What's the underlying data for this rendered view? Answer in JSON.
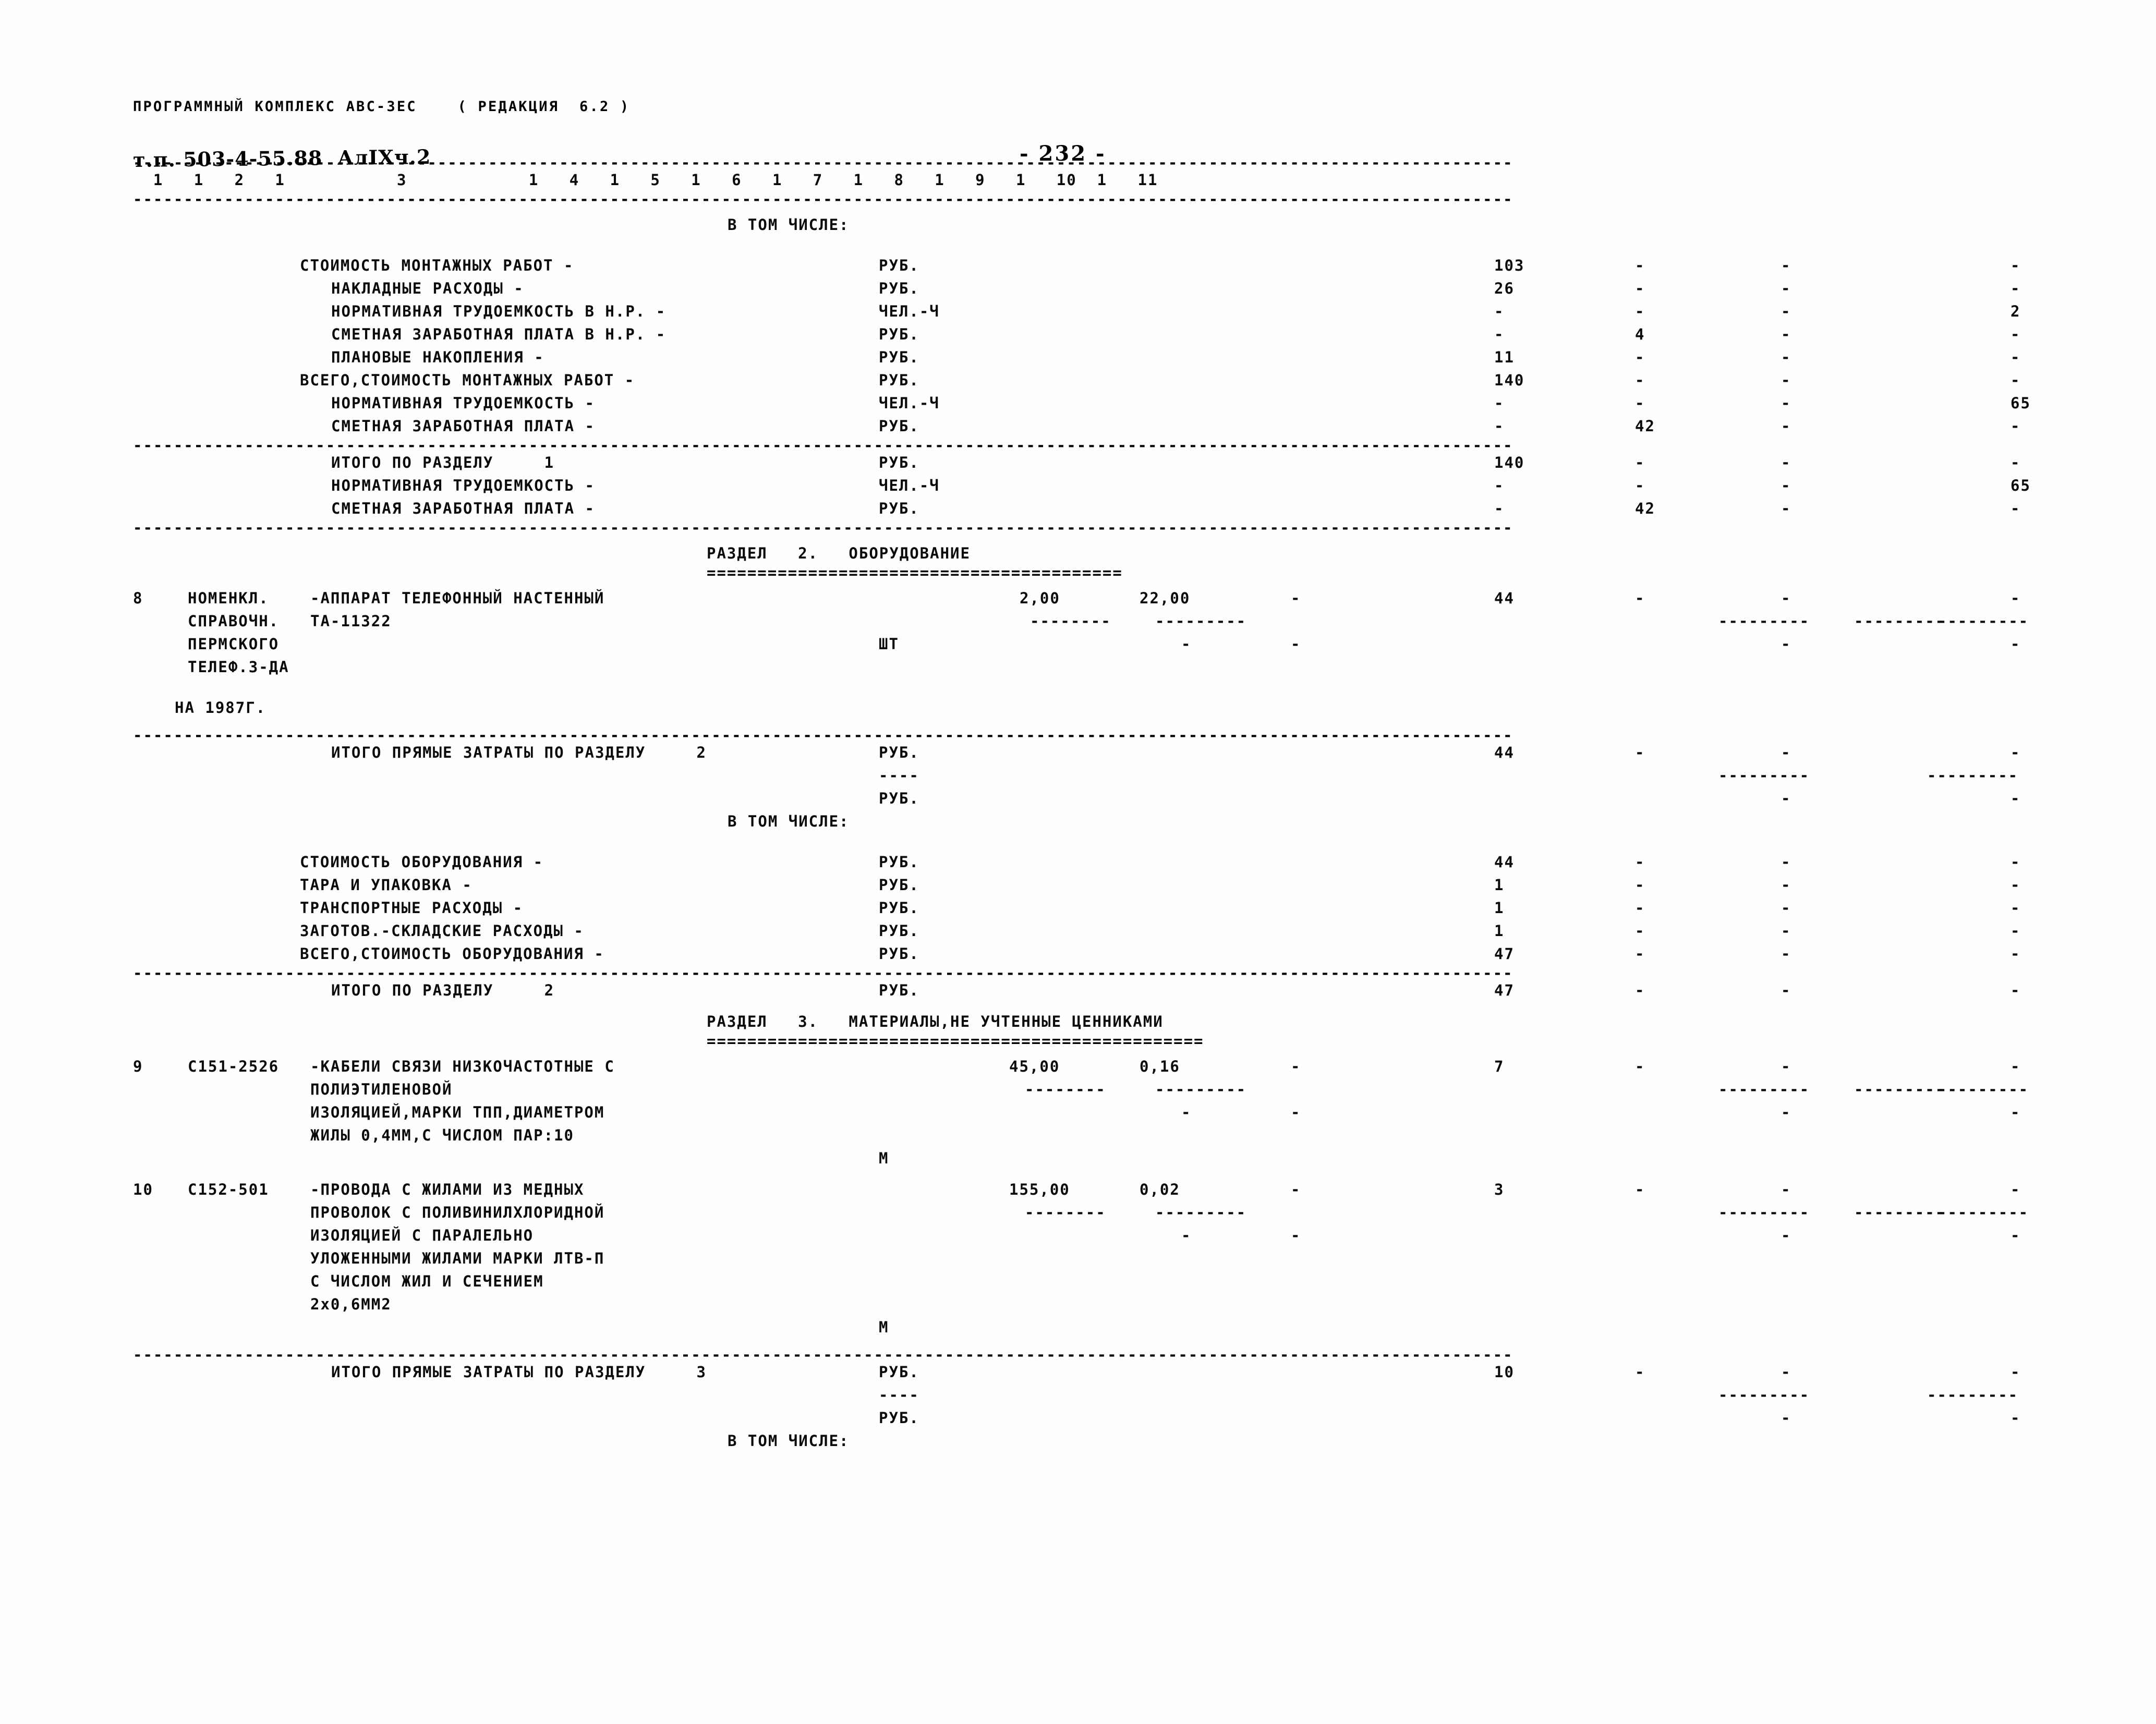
{
  "header": {
    "program_line": "ПРОГРАММНЫЙ КОМПЛЕКС АВС-ЗЕС    ( РЕДАКЦИЯ  6.2 )",
    "handwritten_annotation": "т.п. 503-4-55.88  АлIХч.2",
    "page_number": "- 232 -",
    "column_numbers": "  1   1   2   1           3            1   4   1   5   1   6   1   7   1   8   1   9   1   10  1   11",
    "rule_top": "----------------------------------------------------------------------------------------------------------------------------------------",
    "rule_under_columns": "----------------------------------------------------------------------------------------------------------------------------------------"
  },
  "section1": {
    "in_which_label": "В ТОМ ЧИСЛЕ:",
    "rows": [
      {
        "label": "СТОИМОСТЬ МОНТАЖНЫХ РАБОТ -",
        "indent": 0,
        "unit": "РУБ.",
        "c7": "103",
        "c8": "-",
        "c9": "-",
        "c11": "-"
      },
      {
        "label": "НАКЛАДНЫЕ РАСХОДЫ -",
        "indent": 1,
        "unit": "РУБ.",
        "c7": "26",
        "c8": "-",
        "c9": "-",
        "c11": "-"
      },
      {
        "label": "НОРМАТИВНАЯ ТРУДОЕМКОСТЬ В Н.Р. -",
        "indent": 1,
        "unit": "ЧЕЛ.-Ч",
        "c7": "-",
        "c8": "-",
        "c9": "-",
        "c11": "2"
      },
      {
        "label": "СМЕТНАЯ ЗАРАБОТНАЯ ПЛАТА В Н.Р. -",
        "indent": 1,
        "unit": "РУБ.",
        "c7": "-",
        "c8": "4",
        "c9": "-",
        "c11": "-"
      },
      {
        "label": "ПЛАНОВЫЕ НАКОПЛЕНИЯ -",
        "indent": 1,
        "unit": "РУБ.",
        "c7": "11",
        "c8": "-",
        "c9": "-",
        "c11": "-"
      },
      {
        "label": "ВСЕГО,СТОИМОСТЬ МОНТАЖНЫХ РАБОТ -",
        "indent": 0,
        "unit": "РУБ.",
        "c7": "140",
        "c8": "-",
        "c9": "-",
        "c11": "-"
      },
      {
        "label": "НОРМАТИВНАЯ ТРУДОЕМКОСТЬ -",
        "indent": 1,
        "unit": "ЧЕЛ.-Ч",
        "c7": "-",
        "c8": "-",
        "c9": "-",
        "c11": "65"
      },
      {
        "label": "СМЕТНАЯ ЗАРАБОТНАЯ ПЛАТА -",
        "indent": 1,
        "unit": "РУБ.",
        "c7": "-",
        "c8": "42",
        "c9": "-",
        "c11": "-"
      }
    ],
    "totals": [
      {
        "label": "ИТОГО ПО РАЗДЕЛУ     1",
        "indent": 1,
        "unit": "РУБ.",
        "c7": "140",
        "c8": "-",
        "c9": "-",
        "c11": "-"
      },
      {
        "label": "НОРМАТИВНАЯ ТРУДОЕМКОСТЬ -",
        "indent": 1,
        "unit": "ЧЕЛ.-Ч",
        "c7": "-",
        "c8": "-",
        "c9": "-",
        "c11": "65"
      },
      {
        "label": "СМЕТНАЯ ЗАРАБОТНАЯ ПЛАТА -",
        "indent": 1,
        "unit": "РУБ.",
        "c7": "-",
        "c8": "42",
        "c9": "-",
        "c11": "-"
      }
    ]
  },
  "section2": {
    "title": "РАЗДЕЛ   2.   ОБОРУДОВАНИЕ",
    "title_rule": "=========================================",
    "item": {
      "number": "8",
      "source_lines": [
        "НОМЕНКЛ.",
        "СПРАВОЧН.",
        "ПЕРМСКОГО",
        "ТЕЛЕФ.З-ДА"
      ],
      "code": "ТА-11322",
      "desc_lines": [
        "-АППАРАТ ТЕЛЕФОННЫЙ НАСТЕННЫЙ"
      ],
      "unit": "ШТ",
      "qty": "2,00",
      "price": "22,00",
      "c6": "-",
      "c7": "44",
      "c8": "-",
      "c9": "-",
      "c11": "-",
      "dash_row_a": "--------",
      "dash_row_b": "---------",
      "dash_row_c": "---------",
      "dash_row_d": "---------",
      "dash_row_e": "---------"
    },
    "year_note": "НА 1987Г.",
    "direct_total": {
      "label": "ИТОГО ПРЯМЫЕ ЗАТРАТЫ ПО РАЗДЕЛУ     2",
      "unit1": "РУБ.",
      "unit_underline": "----",
      "unit2": "РУБ.",
      "c7": "44",
      "c8": "-",
      "c9_dash": "---------",
      "c9": "-",
      "c11_dash": "---------",
      "c11": "-"
    },
    "in_which_label": "В ТОМ ЧИСЛЕ:",
    "rows": [
      {
        "label": "СТОИМОСТЬ ОБОРУДОВАНИЯ -",
        "unit": "РУБ.",
        "c7": "44",
        "c8": "-",
        "c9": "-",
        "c11": "-"
      },
      {
        "label": "ТАРА И УПАКОВКА -",
        "unit": "РУБ.",
        "c7": "1",
        "c8": "-",
        "c9": "-",
        "c11": "-"
      },
      {
        "label": "ТРАНСПОРТНЫЕ РАСХОДЫ -",
        "unit": "РУБ.",
        "c7": "1",
        "c8": "-",
        "c9": "-",
        "c11": "-"
      },
      {
        "label": "ЗАГОТОВ.-СКЛАДСКИЕ РАСХОДЫ -",
        "unit": "РУБ.",
        "c7": "1",
        "c8": "-",
        "c9": "-",
        "c11": "-"
      },
      {
        "label": "ВСЕГО,СТОИМОСТЬ ОБОРУДОВАНИЯ -",
        "unit": "РУБ.",
        "c7": "47",
        "c8": "-",
        "c9": "-",
        "c11": "-"
      }
    ],
    "section_total": {
      "label": "ИТОГО ПО РАЗДЕЛУ     2",
      "unit": "РУБ.",
      "c7": "47",
      "c8": "-",
      "c9": "-",
      "c11": "-"
    }
  },
  "section3": {
    "title": "РАЗДЕЛ   3.   МАТЕРИАЛЫ,НЕ УЧТЕННЫЕ ЦЕННИКАМИ",
    "title_rule": "=================================================",
    "items": [
      {
        "number": "9",
        "code": "С151-2526",
        "desc_lines": [
          "-КАБЕЛИ СВЯЗИ НИЗКОЧАСТОТНЫЕ С",
          "ПОЛИЭТИЛЕНОВОЙ",
          "ИЗОЛЯЦИЕЙ,МАРКИ ТПП,ДИАМЕТРОМ",
          "ЖИЛЫ 0,4ММ,С ЧИСЛОМ ПАР:10"
        ],
        "unit": "М",
        "qty": "45,00",
        "price": "0,16",
        "c6": "-",
        "c7": "7",
        "c8": "-",
        "c9": "-",
        "c11": "-"
      },
      {
        "number": "10",
        "code": "С152-501",
        "desc_lines": [
          "-ПРОВОДА С ЖИЛАМИ ИЗ МЕДНЫХ",
          "ПРОВОЛОК С ПОЛИВИНИЛХЛОРИДНОЙ",
          "ИЗОЛЯЦИЕЙ С ПАРАЛЕЛЬНО",
          "УЛОЖЕННЫМИ ЖИЛАМИ МАРКИ ЛТВ-П",
          "С ЧИСЛОМ ЖИЛ И СЕЧЕНИЕМ",
          "2х0,6ММ2"
        ],
        "unit": "М",
        "qty": "155,00",
        "price": "0,02",
        "c6": "-",
        "c7": "3",
        "c8": "-",
        "c9": "-",
        "c11": "-"
      }
    ],
    "direct_total": {
      "label": "ИТОГО ПРЯМЫЕ ЗАТРАТЫ ПО РАЗДЕЛУ     3",
      "unit1": "РУБ.",
      "unit_underline": "----",
      "unit2": "РУБ.",
      "c7": "10",
      "c8": "-",
      "c9_dash": "---------",
      "c9": "-",
      "c11_dash": "---------",
      "c11": "-"
    },
    "in_which_label": "В ТОМ ЧИСЛЕ:"
  },
  "glyphs": {
    "dash_run_long": "---------",
    "dash_run_short": "--------",
    "dot": "-"
  }
}
